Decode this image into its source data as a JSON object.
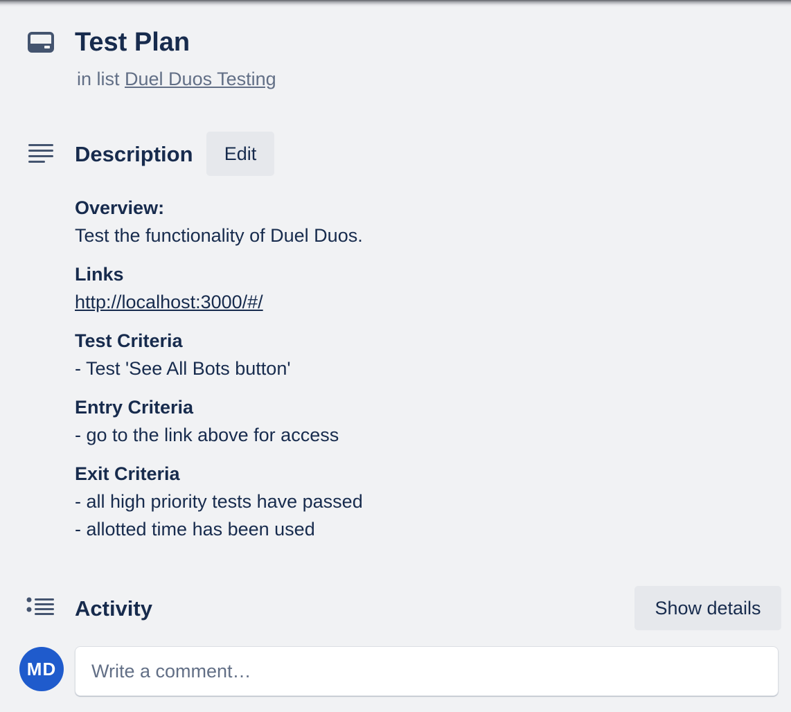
{
  "card": {
    "title": "Test Plan",
    "in_list_prefix": "in list",
    "list_name": "Duel Duos Testing"
  },
  "description": {
    "title": "Description",
    "edit_label": "Edit",
    "blocks": [
      {
        "heading": "Overview:",
        "lines": [
          "Test the functionality of Duel Duos."
        ]
      },
      {
        "heading": "Links",
        "link": "http://localhost:3000/#/"
      },
      {
        "heading": "Test Criteria",
        "lines": [
          "- Test 'See All Bots button'"
        ]
      },
      {
        "heading": "Entry Criteria",
        "lines": [
          "- go to the link above for access"
        ]
      },
      {
        "heading": "Exit Criteria",
        "lines": [
          "- all high priority tests have passed",
          "- allotted time has been used"
        ]
      }
    ]
  },
  "activity": {
    "title": "Activity",
    "show_details_label": "Show details",
    "avatar_initials": "MD",
    "comment_placeholder": "Write a comment…"
  },
  "icons": {
    "card": "card-icon",
    "description": "description-icon",
    "activity": "activity-icon"
  },
  "colors": {
    "background": "#f1f2f4",
    "text": "#172b4d",
    "subtle_text": "#626f86",
    "button_bg": "#e6e8ec",
    "avatar_bg": "#1f5bcc"
  }
}
